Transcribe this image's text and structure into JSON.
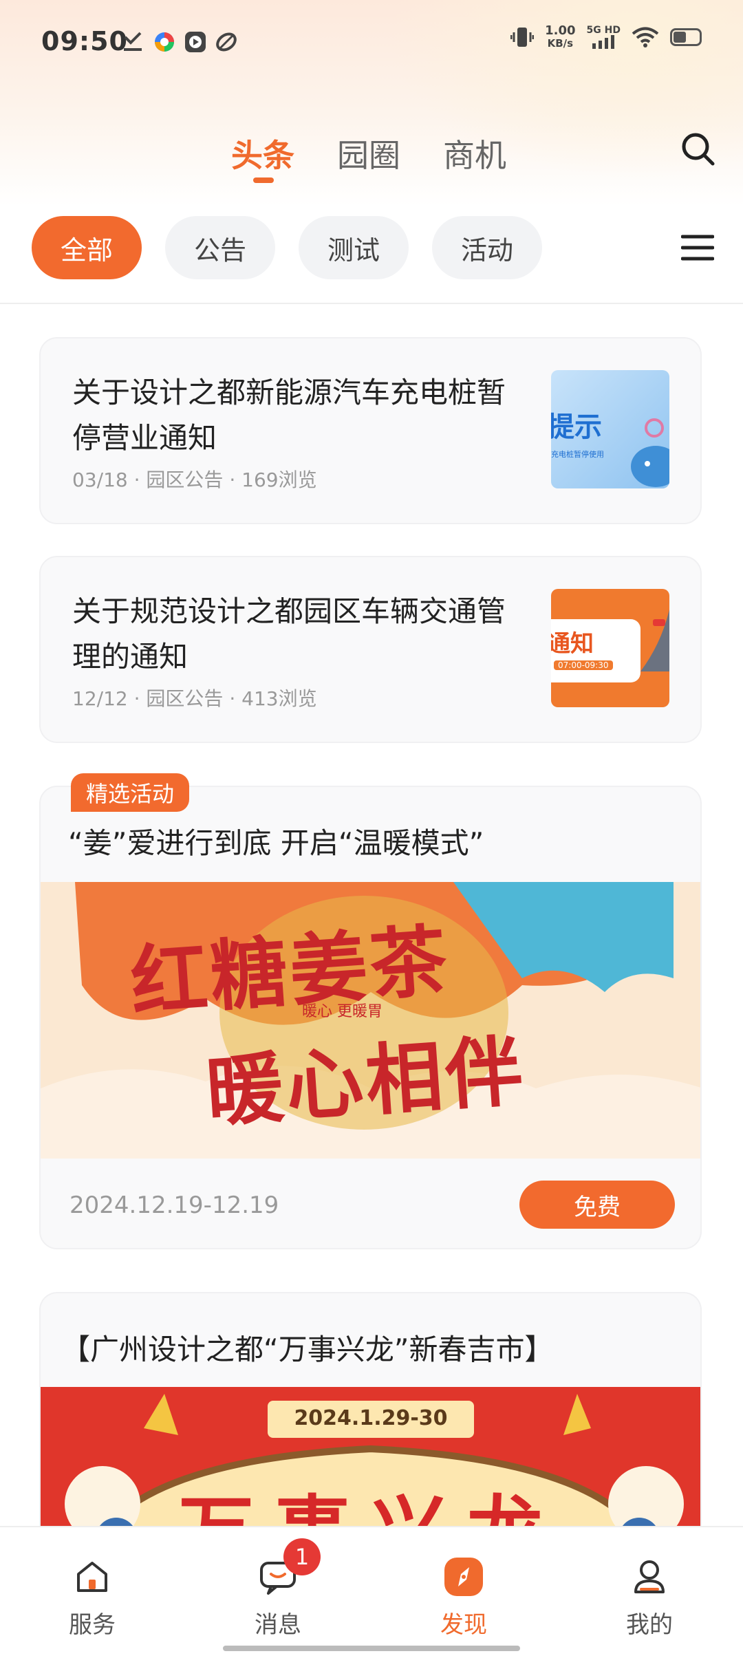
{
  "status_bar": {
    "time": "09:50",
    "speed_value": "1.00",
    "speed_unit": "KB/s",
    "network": "5G HD"
  },
  "header": {
    "tabs": [
      {
        "label": "头条",
        "active": true
      },
      {
        "label": "园圈",
        "active": false
      },
      {
        "label": "商机",
        "active": false
      }
    ]
  },
  "filters": [
    {
      "label": "全部",
      "active": true
    },
    {
      "label": "公告",
      "active": false
    },
    {
      "label": "测试",
      "active": false
    },
    {
      "label": "活动",
      "active": false
    }
  ],
  "news": [
    {
      "title": "关于设计之都新能源汽车充电桩暂停营业通知",
      "date": "03/18",
      "category": "园区公告",
      "views": "169浏览",
      "thumb_text": "提示",
      "thumb_sub": "充电桩暂停使用"
    },
    {
      "title": "关于规范设计之都园区车辆交通管理的通知",
      "date": "12/12",
      "category": "园区公告",
      "views": "413浏览",
      "thumb_text": "通知",
      "thumb_sub": "07:00-09:30"
    }
  ],
  "activity": {
    "badge": "精选活动",
    "title": "“姜”爱进行到底 开启“温暖模式”",
    "banner_line1": "红糖姜茶",
    "banner_line2": "暖心相伴",
    "banner_small": "暖心 更暖胃",
    "date_range": "2024.12.19-12.19",
    "price_label": "免费"
  },
  "activity2": {
    "title": "【广州设计之都“万事兴龙”新春吉市】",
    "banner_date": "2024.1.29-30",
    "banner_text": "万事兴龙"
  },
  "bottom_nav": {
    "items": [
      {
        "label": "服务",
        "icon": "home-icon"
      },
      {
        "label": "消息",
        "icon": "message-icon"
      },
      {
        "label": "发现",
        "icon": "compass-icon"
      },
      {
        "label": "我的",
        "icon": "user-icon"
      }
    ],
    "message_badge": "1"
  },
  "colors": {
    "accent": "#f06a2d",
    "badge_red": "#e53935"
  }
}
